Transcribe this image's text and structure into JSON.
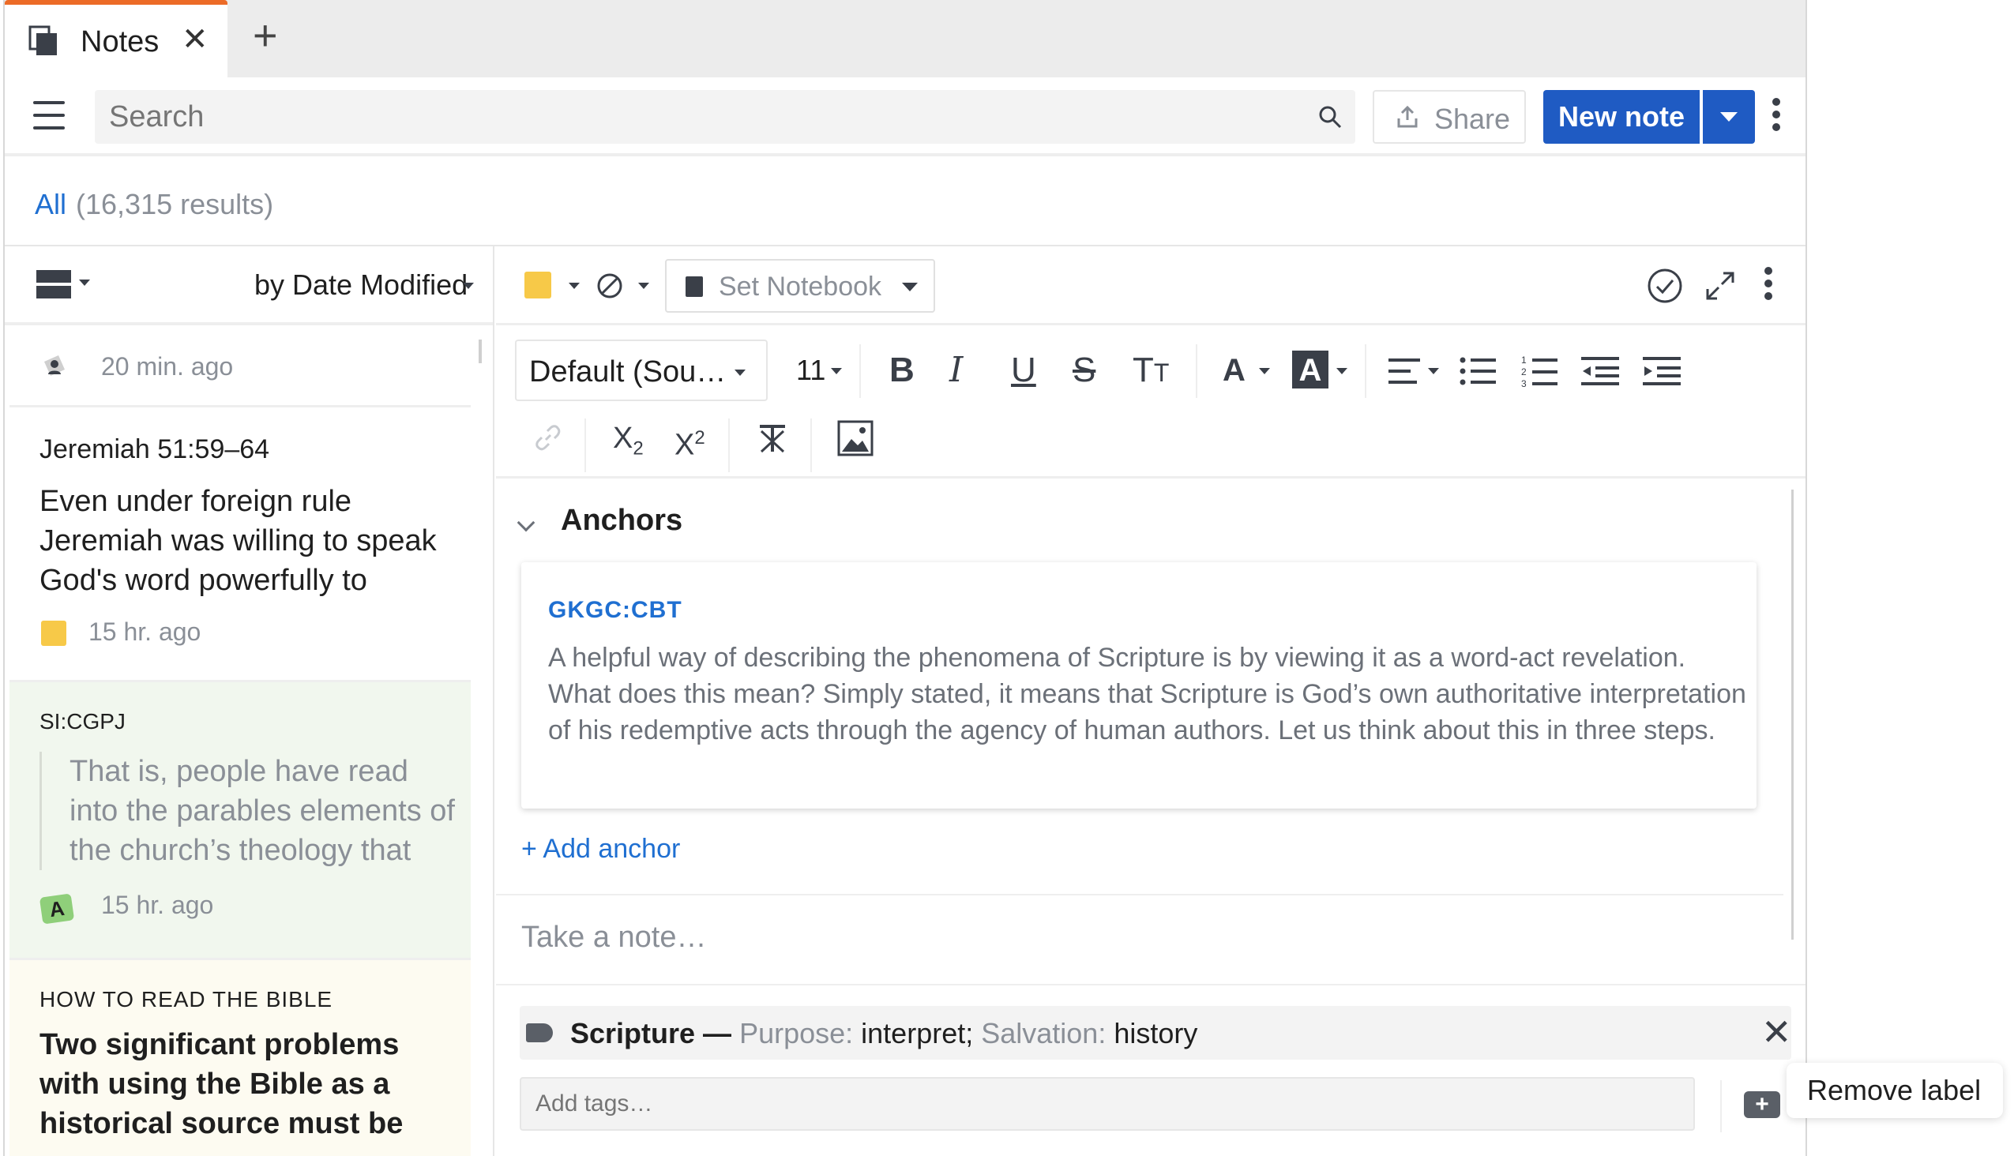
{
  "tabs": [
    {
      "label": "Notes"
    }
  ],
  "toolbar": {
    "search_placeholder": "Search",
    "share_label": "Share",
    "new_note_label": "New note"
  },
  "results": {
    "filter": "All",
    "count": "(16,315 results)"
  },
  "list": {
    "sort_label": "by Date Modified",
    "items": [
      {
        "time": "20 min. ago"
      },
      {
        "reference": "Jeremiah 51:59–64",
        "body": "Even under foreign rule Jeremiah was willing to speak God's word powerfully to those",
        "time": "15 hr. ago"
      },
      {
        "reference": "SI:CGPJ",
        "quote": "That is, people have read into the parables elements of the church’s theology that had",
        "author_initial": "A",
        "time": "15 hr. ago"
      },
      {
        "category": "HOW TO READ THE BIBLE",
        "title": "Two significant problems with using the Bible as a historical source must be"
      }
    ]
  },
  "editor": {
    "notebook_placeholder": "Set Notebook",
    "font_family": "Default (Sou…",
    "font_size": "11",
    "anchors_heading": "Anchors",
    "anchor": {
      "reference": "GKGC:CBT",
      "text": "A helpful way of describing the phenomena of Scripture is by viewing it as a word-act revelation. What does this mean? Simply stated, it means that Scripture is God’s own authoritative interpretation of his redemptive acts through the agency of human authors. Let us think about this in three steps."
    },
    "add_anchor": "+ Add anchor",
    "note_placeholder": "Take a note…",
    "label": {
      "name": "Scripture",
      "dash": " — ",
      "k1": "Purpose:",
      "v1": " interpret;",
      "k2": " Salvation:",
      "v2": " history"
    },
    "tags_placeholder": "Add tags…"
  },
  "tooltip": "Remove label",
  "colors": {
    "accent": "#1f5bc3",
    "link": "#1f6fd1",
    "tab_indicator": "#ec6b27",
    "sticky": "#f7c948"
  }
}
